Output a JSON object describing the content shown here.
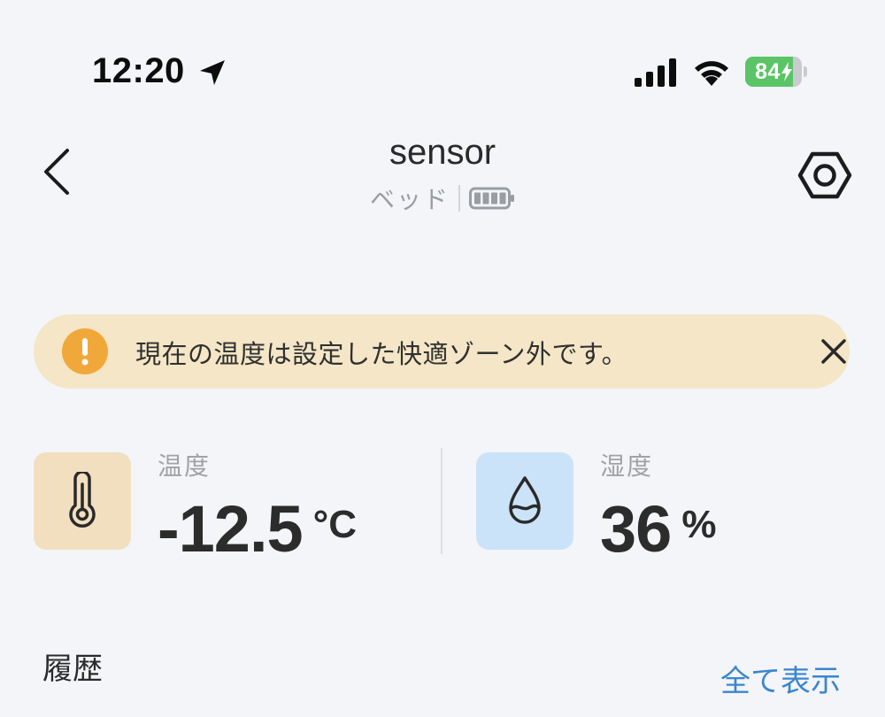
{
  "status_bar": {
    "time": "12:20",
    "battery_percent": 84,
    "battery_text": "84",
    "battery_charging": true,
    "icons": [
      "location-arrow-icon",
      "cellular-signal-icon",
      "wifi-icon",
      "battery-icon",
      "charging-bolt-icon"
    ]
  },
  "header": {
    "title": "sensor",
    "room": "ベッド",
    "device_battery_level": "full",
    "icons": [
      "back-chevron-icon",
      "device-battery-icon",
      "settings-hexagon-icon"
    ]
  },
  "alert": {
    "message": "現在の温度は設定した快適ゾーン外です。",
    "icons": [
      "warning-exclamation-icon",
      "close-icon"
    ],
    "color": "#f4e6c6",
    "icon_color": "#f1a83a"
  },
  "metrics": {
    "temperature": {
      "label": "温度",
      "value": "-12.5",
      "unit": "°C",
      "icon": "thermometer-icon",
      "tile_color": "#f2dfc0"
    },
    "humidity": {
      "label": "湿度",
      "value": "36",
      "unit": "%",
      "icon": "water-drop-icon",
      "tile_color": "#cbe3f8"
    }
  },
  "history": {
    "title": "履歴",
    "view_all": "全て表示",
    "link_color": "#3a86cf"
  }
}
